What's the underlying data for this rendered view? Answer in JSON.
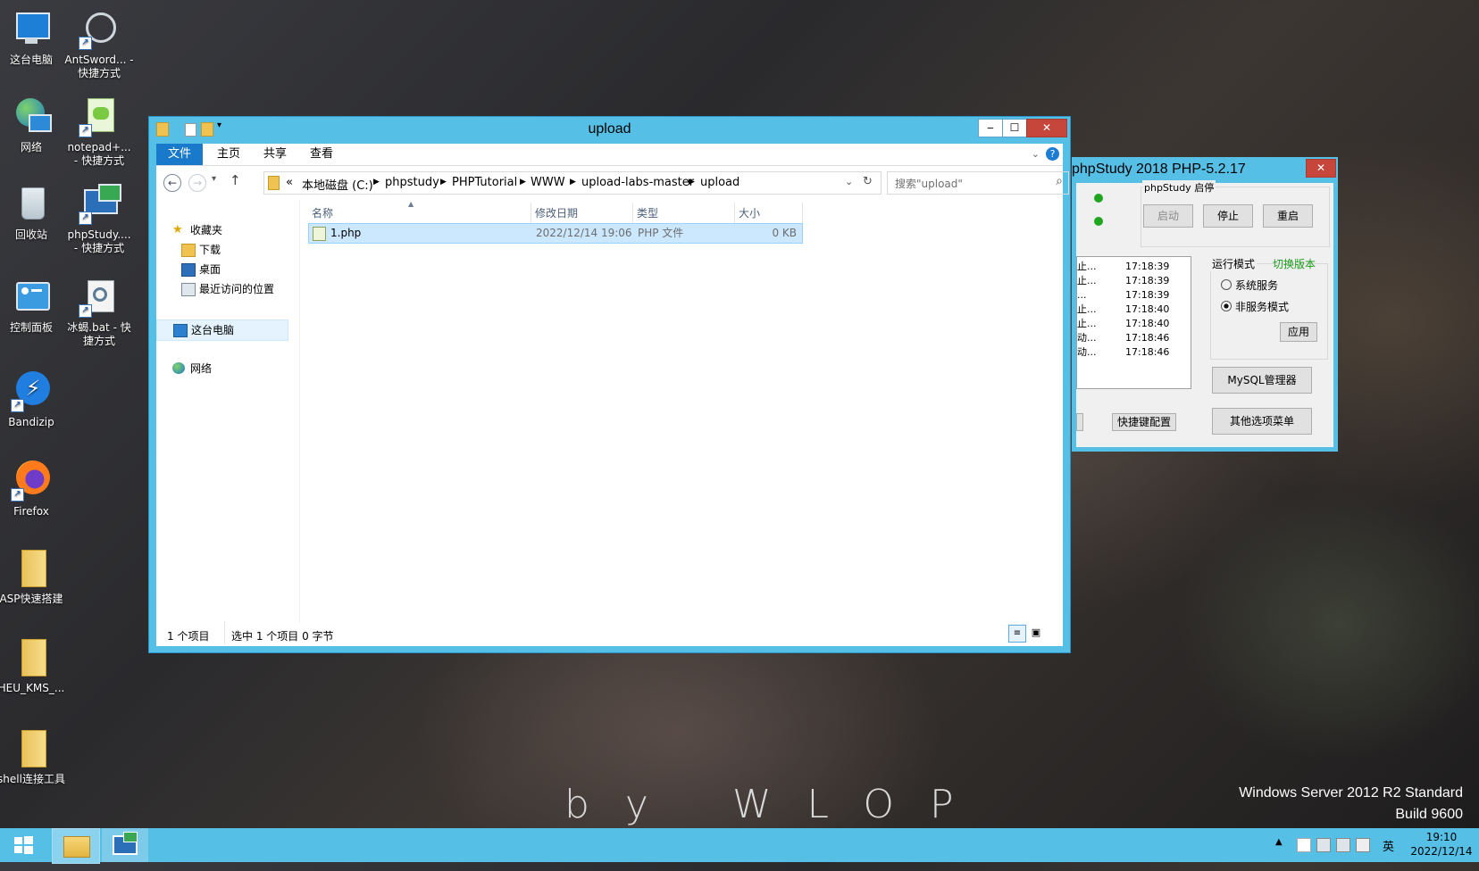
{
  "desktop": {
    "icons": [
      {
        "label": "这台电脑"
      },
      {
        "label": "AntSword... - 快捷方式"
      },
      {
        "label": "网络"
      },
      {
        "label": "notepad+... - 快捷方式"
      },
      {
        "label": "回收站"
      },
      {
        "label": "phpStudy.... - 快捷方式"
      },
      {
        "label": "控制面板"
      },
      {
        "label": "冰蝎.bat - 快捷方式"
      },
      {
        "label": "Bandizip"
      },
      {
        "label": "Firefox"
      },
      {
        "label": "ASP快速搭建"
      },
      {
        "label": "HEU_KMS_..."
      },
      {
        "label": "shell连接工具"
      }
    ],
    "wallpaper_text": "by WLOP",
    "watermark_line1": "Windows Server 2012 R2 Standard",
    "watermark_line2": "Build 9600"
  },
  "explorer": {
    "title": "upload",
    "tabs": [
      "文件",
      "主页",
      "共享",
      "查看"
    ],
    "breadcrumb": [
      "«",
      "本地磁盘 (C:)",
      "phpstudy",
      "PHPTutorial",
      "WWW",
      "upload-labs-master",
      "upload"
    ],
    "search_placeholder": "搜索\"upload\"",
    "nav": {
      "favorites": "收藏夹",
      "downloads": "下载",
      "desktop": "桌面",
      "recent": "最近访问的位置",
      "this_pc": "这台电脑",
      "network": "网络"
    },
    "columns": [
      "名称",
      "修改日期",
      "类型",
      "大小"
    ],
    "files": [
      {
        "name": "1.php",
        "modified": "2022/12/14 19:06",
        "type": "PHP 文件",
        "size": "0 KB"
      }
    ],
    "status": {
      "count": "1 个项目",
      "selected": "选中 1 个项目  0 字节"
    }
  },
  "phpstudy": {
    "title": "phpStudy 2018   PHP-5.2.17",
    "group_label": "phpStudy 启停",
    "buttons": {
      "start": "启动",
      "stop": "停止",
      "restart": "重启",
      "apply": "应用",
      "mysql": "MySQL管理器",
      "more": "其他选项菜单",
      "quick": "快捷键配置"
    },
    "mode_label": "运行模式",
    "switch_version": "切换版本",
    "mode_options": [
      "系统服务",
      "非服务模式"
    ],
    "selected_mode": "非服务模式",
    "log": [
      {
        "msg": "止...",
        "time": "17:18:39"
      },
      {
        "msg": "止...",
        "time": "17:18:39"
      },
      {
        "msg": "...",
        "time": "17:18:39"
      },
      {
        "msg": "止...",
        "time": "17:18:40"
      },
      {
        "msg": "止...",
        "time": "17:18:40"
      },
      {
        "msg": "动...",
        "time": "17:18:46"
      },
      {
        "msg": "动...",
        "time": "17:18:46"
      }
    ]
  },
  "taskbar": {
    "lang": "英",
    "time": "19:10",
    "date": "2022/12/14"
  },
  "colors": {
    "accent": "#56bfe6",
    "selection": "#cce8ff",
    "ribbon_file_tab": "#1979ca"
  }
}
